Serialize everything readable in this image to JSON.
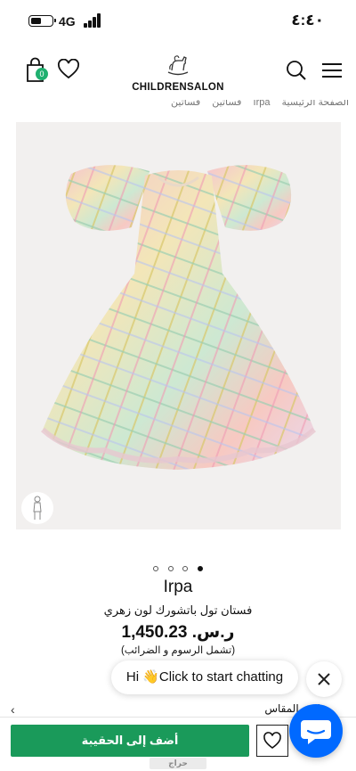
{
  "status_bar": {
    "network": "4G",
    "time": "٤:٤٠",
    "battery_level": 0.4
  },
  "header": {
    "logo_text": "CHILDRENSALON",
    "bag_count": "0",
    "icons": [
      "shopping-bag-icon",
      "heart-icon",
      "rocking-horse-logo",
      "search-icon",
      "hamburger-menu-icon"
    ]
  },
  "breadcrumb": [
    "الصفحة الرئيسية",
    "Irpa",
    "فساتين",
    "فساتين"
  ],
  "gallery": {
    "image_description_icon": "dress-image",
    "page_count": 4,
    "active_page": 4
  },
  "product": {
    "brand": "Irpa",
    "title": "فستان تول باتشورك لون زهري",
    "price": "ر.س. 1,450.23",
    "tax_note": "(تشمل الرسوم و الضرائب)"
  },
  "chat": {
    "prompt": "Hi 👋Click to start chatting"
  },
  "size_row": {
    "label": "اختر المقاس"
  },
  "actions": {
    "add_to_bag": "أضف إلى الحقيبة"
  },
  "watermark": {
    "text": "حراج"
  },
  "colors": {
    "accent_green": "#1a9a5a",
    "chat_blue": "#0069ff",
    "badge_green": "#20b070"
  }
}
